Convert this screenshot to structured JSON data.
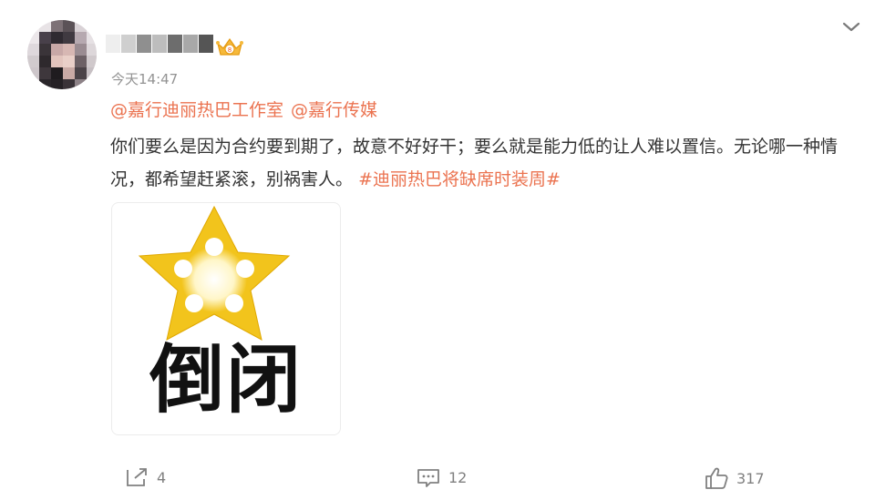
{
  "post": {
    "time": "今天14:47",
    "mentions": [
      "@嘉行迪丽热巴工作室",
      "@嘉行传媒"
    ],
    "body": "你们要么是因为合约要到期了，故意不好好干；要么就是能力低的让人难以置信。无论哪一种情况，都希望赶紧滚，别祸害人。",
    "hashtag": "#迪丽热巴将缺席时装周#",
    "image_text": "倒闭"
  },
  "actions": {
    "repost_count": "4",
    "comment_count": "12",
    "like_count": "317"
  },
  "icons": {
    "vip": "crown-badge-icon",
    "more": "chevron-down-icon",
    "repost": "share-arrow-icon",
    "comment": "comment-bubble-icon",
    "like": "thumbs-up-icon"
  },
  "colors": {
    "accent": "#eb7350",
    "text": "#333333",
    "meta": "#939393",
    "star": "#f2c41c"
  }
}
